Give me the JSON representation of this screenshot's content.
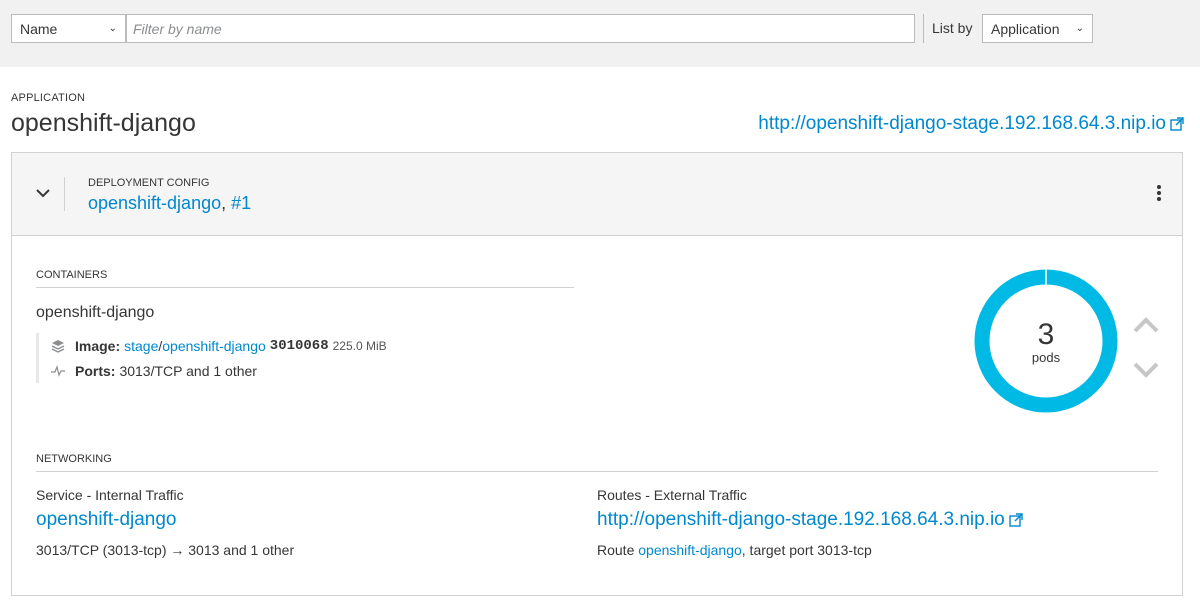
{
  "filter": {
    "field_select": "Name",
    "placeholder": "Filter by name",
    "value": "",
    "list_by_label": "List by",
    "list_by_value": "Application"
  },
  "application": {
    "label": "APPLICATION",
    "name": "openshift-django",
    "route_url": "http://openshift-django-stage.192.168.64.3.nip.io"
  },
  "deployment": {
    "label": "DEPLOYMENT CONFIG",
    "name": "openshift-django",
    "separator": ", ",
    "revision": "#1"
  },
  "containers": {
    "label": "CONTAINERS",
    "name": "openshift-django",
    "image_label": "Image:",
    "image_namespace": "stage",
    "image_slash": "/",
    "image_name": "openshift-django",
    "image_id": "3010068",
    "image_size": "225.0 MiB",
    "ports_label": "Ports:",
    "ports_value": "3013/TCP and 1 other"
  },
  "pods": {
    "count": "3",
    "label": "pods",
    "ring_color": "#00b9e4"
  },
  "networking": {
    "label": "NETWORKING",
    "service_heading": "Service - Internal Traffic",
    "service_name": "openshift-django",
    "service_ports": "3013/TCP (3013-tcp) → 3013 and 1 other",
    "routes_heading": "Routes - External Traffic",
    "route_url": "http://openshift-django-stage.192.168.64.3.nip.io",
    "route_prefix": "Route ",
    "route_name": "openshift-django",
    "route_suffix": ", target port 3013-tcp"
  },
  "colors": {
    "link": "#0088ce",
    "header_bg": "#f5f5f5",
    "filter_bg": "#f1f1f1"
  },
  "icons": [
    "chevron-down-icon",
    "external-link-icon",
    "kebab-icon",
    "image-layers-icon",
    "ports-pulse-icon",
    "scale-up-icon",
    "scale-down-icon"
  ]
}
